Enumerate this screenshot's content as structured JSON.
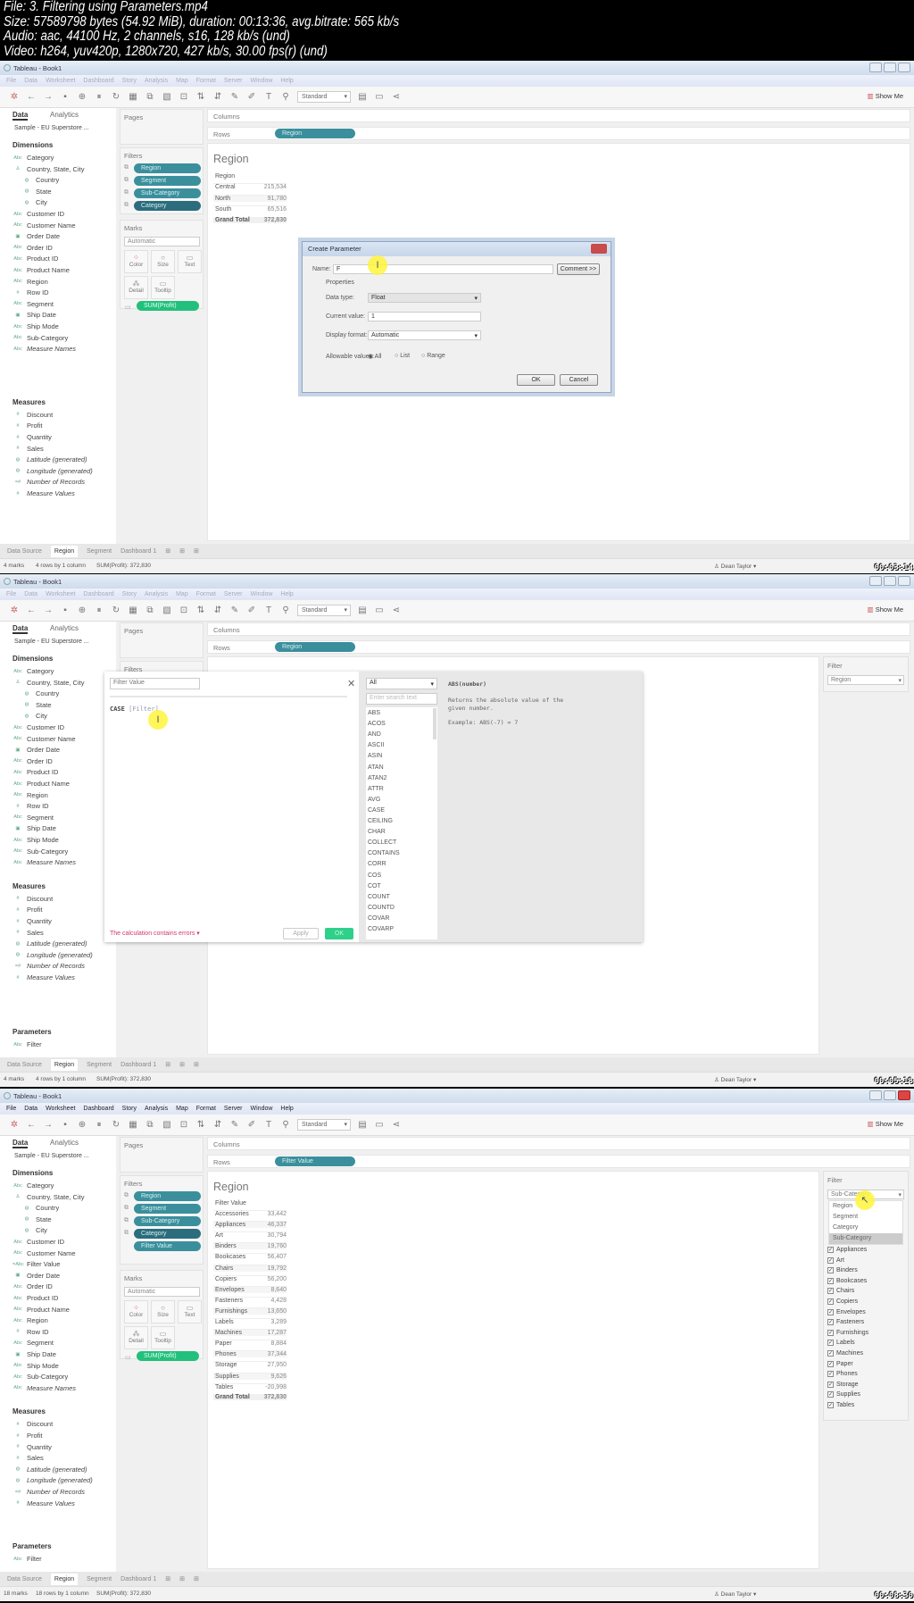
{
  "header": {
    "lines": [
      "File: 3. Filtering using Parameters.mp4",
      "Size: 57589798 bytes (54.92 MiB), duration: 00:13:36, avg.bitrate: 565 kb/s",
      "Audio: aac, 44100 Hz, 2 channels, s16, 128 kb/s (und)",
      "Video: h264, yuv420p, 1280x720, 427 kb/s, 30.00 fps(r) (und)"
    ]
  },
  "app": {
    "window_title": "Tableau - Book1",
    "menu": [
      "File",
      "Data",
      "Worksheet",
      "Dashboard",
      "Story",
      "Analysis",
      "Map",
      "Format",
      "Server",
      "Window",
      "Help"
    ],
    "toolbar_icons": [
      "tableau-logo-icon",
      "undo-icon",
      "redo-icon",
      "save-icon",
      "new-datasource-icon",
      "pause-icon",
      "refresh-icon",
      "new-sheet-icon",
      "duplicate-sheet-icon",
      "clear-sheet-icon",
      "swap-icon",
      "sort-asc-icon",
      "sort-desc-icon",
      "highlight-icon",
      "group-icon",
      "labels-icon",
      "pin-icon"
    ],
    "fit_label": "Standard",
    "show_me_label": "Show Me",
    "data_tab": "Data",
    "analytics_tab": "Analytics",
    "datasource": "Sample - EU Superstore ...",
    "dimensions_label": "Dimensions",
    "measures_label": "Measures",
    "parameters_label": "Parameters",
    "pages_label": "Pages",
    "filters_label": "Filters",
    "marks_label": "Marks",
    "marks_type": "Automatic",
    "marks_buttons": [
      "Color",
      "Size",
      "Text",
      "Detail",
      "Tooltip"
    ],
    "marks_pill": "SUM(Profit)",
    "columns_label": "Columns",
    "rows_label": "Rows",
    "sheet_tabs": [
      "Data Source",
      "Region",
      "Segment",
      "Dashboard 1"
    ],
    "user": "Dean Taylor",
    "measures": [
      {
        "label": "Discount",
        "icon": "number",
        "italic": false
      },
      {
        "label": "Profit",
        "icon": "number",
        "italic": false
      },
      {
        "label": "Quantity",
        "icon": "number",
        "italic": false
      },
      {
        "label": "Sales",
        "icon": "number",
        "italic": false
      },
      {
        "label": "Latitude (generated)",
        "icon": "globe",
        "italic": true
      },
      {
        "label": "Longitude (generated)",
        "icon": "globe",
        "italic": true
      },
      {
        "label": "Number of Records",
        "icon": "calc-number",
        "italic": true
      },
      {
        "label": "Measure Values",
        "icon": "number",
        "italic": true
      }
    ],
    "parameters": [
      "Filter"
    ],
    "colors": {
      "pill": "#3b8f9c",
      "pill_dark": "#2b6d7c",
      "pill_green": "#22c07c",
      "error": "#d4386a"
    }
  },
  "frames": [
    {
      "timestamp": "00:03:14",
      "menu_active": false,
      "dimensions": [
        {
          "label": "Category",
          "icon": "abc"
        },
        {
          "label": "Country, State, City",
          "icon": "hierarchy"
        },
        {
          "label": "Country",
          "icon": "globe",
          "indent": true
        },
        {
          "label": "State",
          "icon": "globe",
          "indent": true
        },
        {
          "label": "City",
          "icon": "globe",
          "indent": true
        },
        {
          "label": "Customer ID",
          "icon": "abc"
        },
        {
          "label": "Customer Name",
          "icon": "abc"
        },
        {
          "label": "Order Date",
          "icon": "calendar"
        },
        {
          "label": "Order ID",
          "icon": "abc"
        },
        {
          "label": "Product ID",
          "icon": "abc"
        },
        {
          "label": "Product Name",
          "icon": "abc"
        },
        {
          "label": "Region",
          "icon": "abc"
        },
        {
          "label": "Row ID",
          "icon": "number"
        },
        {
          "label": "Segment",
          "icon": "abc"
        },
        {
          "label": "Ship Date",
          "icon": "calendar"
        },
        {
          "label": "Ship Mode",
          "icon": "abc"
        },
        {
          "label": "Sub-Category",
          "icon": "abc"
        },
        {
          "label": "Measure Names",
          "icon": "abc",
          "italic": true
        }
      ],
      "show_parameters": false,
      "filters": [
        "Region",
        "Segment",
        "Sub-Category",
        "Category"
      ],
      "rows_pill": "Region",
      "view": {
        "title": "Region",
        "header": "Region",
        "rows": [
          [
            "Central",
            "215,534"
          ],
          [
            "North",
            "91,780"
          ],
          [
            "South",
            "65,516"
          ]
        ],
        "total": [
          "Grand Total",
          "372,830"
        ]
      },
      "status": {
        "marks": "4 marks",
        "shape": "4 rows by 1 column",
        "sum": "SUM(Profit): 372,830"
      },
      "dialog": {
        "title": "Create Parameter",
        "name_label": "Name:",
        "name_value": "F",
        "comment_button": "Comment >>",
        "properties_label": "Properties",
        "data_type_label": "Data type:",
        "data_type_value": "Float",
        "current_value_label": "Current value:",
        "current_value": "1",
        "display_format_label": "Display format:",
        "display_format_value": "Automatic",
        "allowable_label": "Allowable values:",
        "allowable_options": [
          "All",
          "List",
          "Range"
        ],
        "allowable_selected": "All",
        "ok_label": "OK",
        "cancel_label": "Cancel"
      }
    },
    {
      "timestamp": "00:05:18",
      "menu_active": false,
      "dimensions": [
        {
          "label": "Category",
          "icon": "abc"
        },
        {
          "label": "Country, State, City",
          "icon": "hierarchy"
        },
        {
          "label": "Country",
          "icon": "globe",
          "indent": true
        },
        {
          "label": "State",
          "icon": "globe",
          "indent": true
        },
        {
          "label": "City",
          "icon": "globe",
          "indent": true
        },
        {
          "label": "Customer ID",
          "icon": "abc"
        },
        {
          "label": "Customer Name",
          "icon": "abc"
        },
        {
          "label": "Order Date",
          "icon": "calendar"
        },
        {
          "label": "Order ID",
          "icon": "abc"
        },
        {
          "label": "Product ID",
          "icon": "abc"
        },
        {
          "label": "Product Name",
          "icon": "abc"
        },
        {
          "label": "Region",
          "icon": "abc"
        },
        {
          "label": "Row ID",
          "icon": "number"
        },
        {
          "label": "Segment",
          "icon": "abc"
        },
        {
          "label": "Ship Date",
          "icon": "calendar"
        },
        {
          "label": "Ship Mode",
          "icon": "abc"
        },
        {
          "label": "Sub-Category",
          "icon": "abc"
        },
        {
          "label": "Measure Names",
          "icon": "abc",
          "italic": true
        }
      ],
      "show_parameters": true,
      "filters": [],
      "rows_pill": "Region",
      "filter_panel": {
        "title": "Filter",
        "value": "Region"
      },
      "status": {
        "marks": "4 marks",
        "shape": "4 rows by 1 column",
        "sum": "SUM(Profit): 372,830"
      },
      "calc": {
        "name": "Filter Value",
        "code_keyword": "CASE",
        "code_field": "[Filter]",
        "error": "The calculation contains errors",
        "apply_label": "Apply",
        "ok_label": "OK",
        "category": "All",
        "search_placeholder": "Enter search text",
        "functions": [
          "ABS",
          "ACOS",
          "AND",
          "ASCII",
          "ASIN",
          "ATAN",
          "ATAN2",
          "ATTR",
          "AVG",
          "CASE",
          "CEILING",
          "CHAR",
          "COLLECT",
          "CONTAINS",
          "CORR",
          "COS",
          "COT",
          "COUNT",
          "COUNTD",
          "COVAR",
          "COVARP"
        ],
        "help_signature": "ABS(number)",
        "help_text": "Returns the absolute value of the given number.",
        "help_example": "Example: ABS(-7) = 7"
      }
    },
    {
      "timestamp": "00:08:30",
      "menu_active": true,
      "dimensions": [
        {
          "label": "Category",
          "icon": "abc"
        },
        {
          "label": "Country, State, City",
          "icon": "hierarchy"
        },
        {
          "label": "Country",
          "icon": "globe",
          "indent": true
        },
        {
          "label": "State",
          "icon": "globe",
          "indent": true
        },
        {
          "label": "City",
          "icon": "globe",
          "indent": true
        },
        {
          "label": "Customer ID",
          "icon": "abc"
        },
        {
          "label": "Customer Name",
          "icon": "abc"
        },
        {
          "label": "Filter Value",
          "icon": "calc-abc"
        },
        {
          "label": "Order Date",
          "icon": "calendar"
        },
        {
          "label": "Order ID",
          "icon": "abc"
        },
        {
          "label": "Product ID",
          "icon": "abc"
        },
        {
          "label": "Product Name",
          "icon": "abc"
        },
        {
          "label": "Region",
          "icon": "abc"
        },
        {
          "label": "Row ID",
          "icon": "number"
        },
        {
          "label": "Segment",
          "icon": "abc"
        },
        {
          "label": "Ship Date",
          "icon": "calendar"
        },
        {
          "label": "Ship Mode",
          "icon": "abc"
        },
        {
          "label": "Sub-Category",
          "icon": "abc"
        },
        {
          "label": "Measure Names",
          "icon": "abc",
          "italic": true
        }
      ],
      "show_parameters": true,
      "filters": [
        "Region",
        "Segment",
        "Sub-Category",
        "Category",
        "Filter Value"
      ],
      "rows_pill": "Filter Value",
      "view": {
        "title": "Region",
        "header": "Filter Value",
        "rows": [
          [
            "Accessories",
            "33,442"
          ],
          [
            "Appliances",
            "46,337"
          ],
          [
            "Art",
            "30,794"
          ],
          [
            "Binders",
            "19,760"
          ],
          [
            "Bookcases",
            "56,407"
          ],
          [
            "Chairs",
            "19,792"
          ],
          [
            "Copiers",
            "56,200"
          ],
          [
            "Envelopes",
            "8,640"
          ],
          [
            "Fasteners",
            "4,428"
          ],
          [
            "Furnishings",
            "13,650"
          ],
          [
            "Labels",
            "3,289"
          ],
          [
            "Machines",
            "17,287"
          ],
          [
            "Paper",
            "8,884"
          ],
          [
            "Phones",
            "37,344"
          ],
          [
            "Storage",
            "27,950"
          ],
          [
            "Supplies",
            "9,626"
          ],
          [
            "Tables",
            "-20,998"
          ]
        ],
        "total": [
          "Grand Total",
          "372,830"
        ]
      },
      "filter_panel": {
        "title": "Filter",
        "value": "Sub-Category",
        "options": [
          "Region",
          "Segment",
          "Category",
          "Sub-Category"
        ],
        "highlighted": "Sub-Category",
        "checklist": [
          "Appliances",
          "Art",
          "Binders",
          "Bookcases",
          "Chairs",
          "Copiers",
          "Envelopes",
          "Fasteners",
          "Furnishings",
          "Labels",
          "Machines",
          "Paper",
          "Phones",
          "Storage",
          "Supplies",
          "Tables"
        ]
      },
      "status": {
        "marks": "18 marks",
        "shape": "18 rows by 1 column",
        "sum": "SUM(Profit): 372,830"
      }
    }
  ]
}
